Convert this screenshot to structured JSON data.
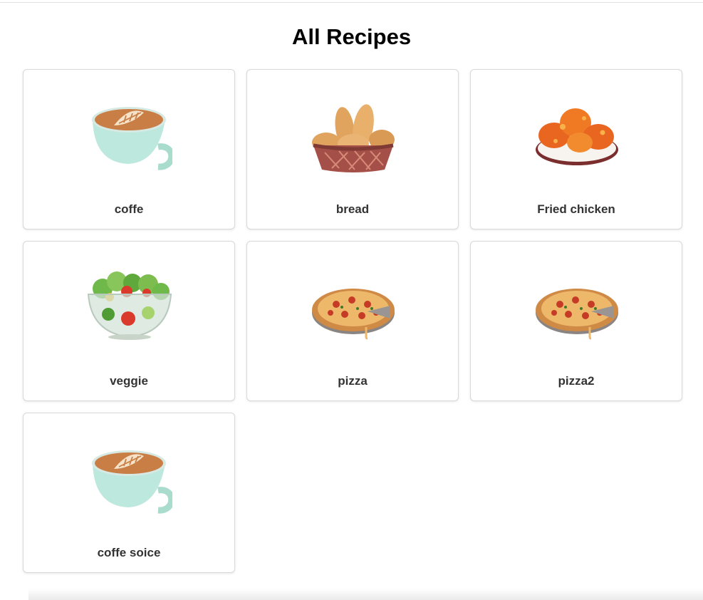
{
  "page": {
    "title": "All Recipes"
  },
  "recipes": [
    {
      "name": "coffe",
      "icon": "coffee-cup-icon"
    },
    {
      "name": "bread",
      "icon": "bread-basket-icon"
    },
    {
      "name": "Fried chicken",
      "icon": "fried-chicken-icon"
    },
    {
      "name": "veggie",
      "icon": "salad-bowl-icon"
    },
    {
      "name": "pizza",
      "icon": "pizza-icon"
    },
    {
      "name": "pizza2",
      "icon": "pizza-icon"
    },
    {
      "name": "coffe soice",
      "icon": "coffee-cup-icon"
    }
  ]
}
